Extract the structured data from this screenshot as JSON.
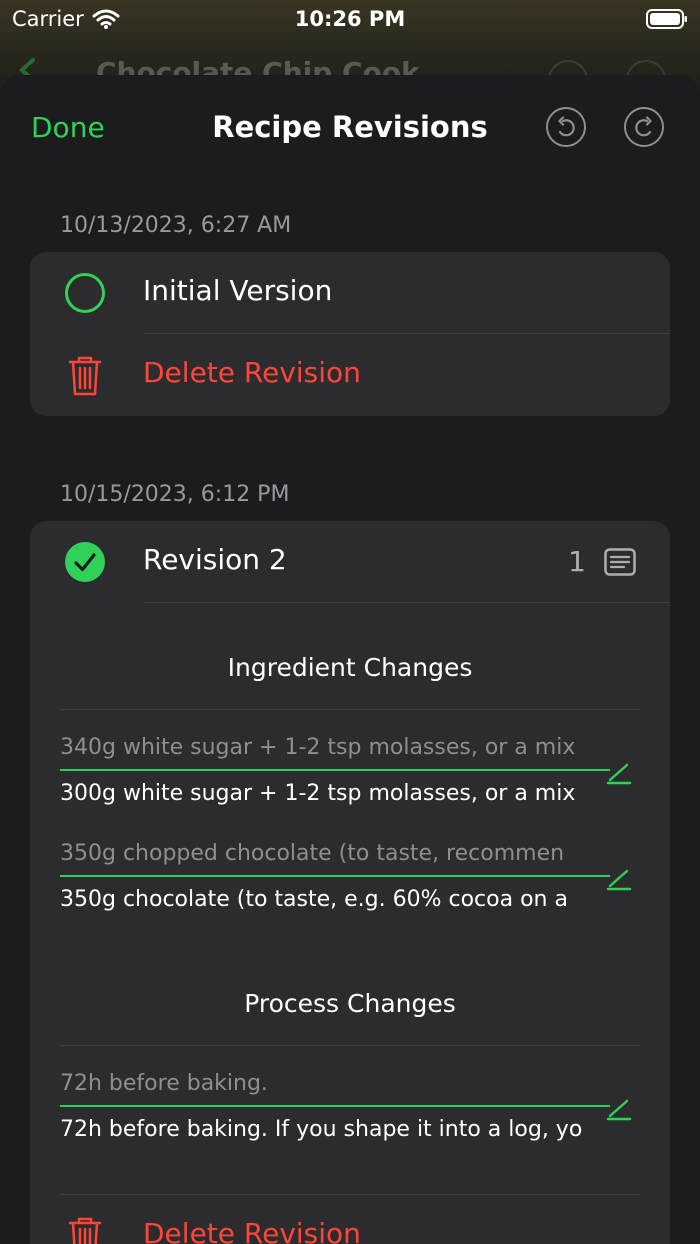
{
  "status_bar": {
    "carrier": "Carrier",
    "time": "10:26 PM"
  },
  "background_screen": {
    "title": "Chocolate Chip Cook"
  },
  "sheet": {
    "done_label": "Done",
    "title": "Recipe Revisions",
    "undo_icon": "undo-icon",
    "redo_icon": "redo-icon"
  },
  "revisions": [
    {
      "date": "10/13/2023, 6:27 AM",
      "name": "Initial Version",
      "selected": false,
      "delete_label": "Delete Revision"
    },
    {
      "date": "10/15/2023, 6:12 PM",
      "name": "Revision 2",
      "selected": true,
      "note_count": "1",
      "ingredient_changes_title": "Ingredient Changes",
      "ingredient_changes": [
        {
          "old": "340g white sugar + 1-2 tsp molasses, or a mix",
          "new": "300g white sugar + 1-2 tsp molasses, or a mix"
        },
        {
          "old": "350g chopped chocolate (to taste, recommen",
          "new": "350g chocolate (to taste, e.g. 60% cocoa on a"
        }
      ],
      "process_changes_title": "Process Changes",
      "process_changes": [
        {
          "old": "72h before baking.",
          "new": "72h before baking. If you shape it into a log, yo"
        }
      ],
      "delete_label": "Delete Revision"
    }
  ],
  "colors": {
    "accent": "#30d158",
    "destructive": "#ff453a",
    "card": "#2c2c2e",
    "sheet": "#1c1c1e"
  }
}
